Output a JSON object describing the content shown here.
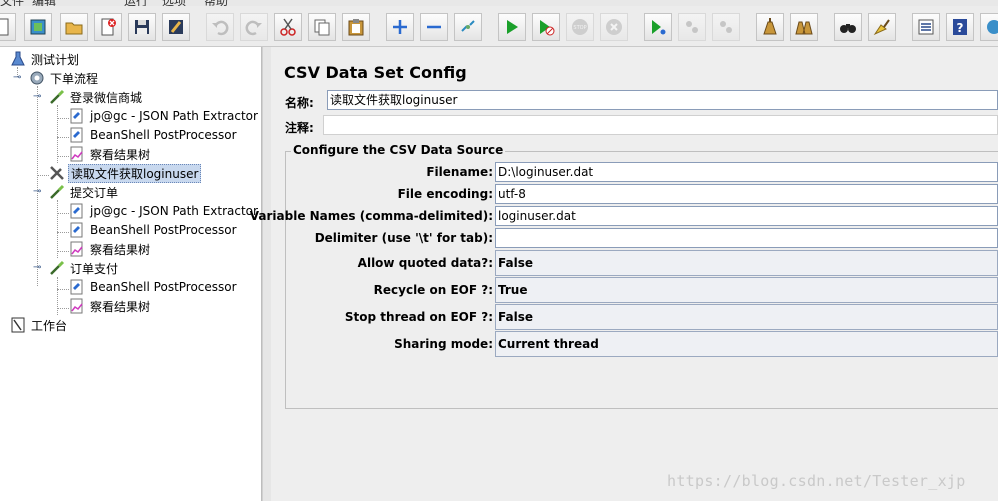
{
  "menubar": {
    "items": [
      "文件",
      "编辑",
      "运行",
      "选项",
      "帮助"
    ]
  },
  "toolbar": {
    "buttons": [
      {
        "name": "new-icon"
      },
      {
        "name": "templates-icon"
      },
      {
        "name": "open-icon"
      },
      {
        "name": "close-icon"
      },
      {
        "name": "save-icon"
      },
      {
        "name": "save-as-icon"
      },
      {
        "name": "undo-icon"
      },
      {
        "name": "redo-icon"
      },
      {
        "name": "cut-icon"
      },
      {
        "name": "copy-icon"
      },
      {
        "name": "paste-icon"
      },
      {
        "name": "expand-icon"
      },
      {
        "name": "collapse-icon"
      },
      {
        "name": "toggle-icon"
      },
      {
        "name": "start-icon"
      },
      {
        "name": "start-no-pause-icon"
      },
      {
        "name": "stop-icon"
      },
      {
        "name": "shutdown-icon"
      },
      {
        "name": "remote-start-icon"
      },
      {
        "name": "remote-stop-icon"
      },
      {
        "name": "remote-shutdown-icon"
      },
      {
        "name": "clear-icon"
      },
      {
        "name": "clear-all-icon"
      },
      {
        "name": "search-icon"
      },
      {
        "name": "reset-search-icon"
      },
      {
        "name": "function-helper-icon"
      },
      {
        "name": "help-icon"
      }
    ]
  },
  "tree": {
    "nodes": [
      {
        "label": "测试计划",
        "icon": "test-plan-icon"
      },
      {
        "label": "下单流程",
        "icon": "thread-group-icon"
      },
      {
        "label": "登录微信商城",
        "icon": "sampler-icon"
      },
      {
        "label": "jp@gc - JSON Path Extractor",
        "icon": "postprocessor-icon"
      },
      {
        "label": "BeanShell PostProcessor",
        "icon": "postprocessor-icon"
      },
      {
        "label": "察看结果树",
        "icon": "listener-icon"
      },
      {
        "label": "读取文件获取loginuser",
        "icon": "config-element-icon"
      },
      {
        "label": "提交订单",
        "icon": "sampler-icon"
      },
      {
        "label": "jp@gc - JSON Path Extractor",
        "icon": "postprocessor-icon"
      },
      {
        "label": "BeanShell PostProcessor",
        "icon": "postprocessor-icon"
      },
      {
        "label": "察看结果树",
        "icon": "listener-icon"
      },
      {
        "label": "订单支付",
        "icon": "sampler-icon"
      },
      {
        "label": "BeanShell PostProcessor",
        "icon": "postprocessor-icon"
      },
      {
        "label": "察看结果树",
        "icon": "listener-icon"
      },
      {
        "label": "工作台",
        "icon": "workbench-icon"
      }
    ]
  },
  "panel": {
    "title": "CSV Data Set Config",
    "name_label": "名称:",
    "name_value": "读取文件获取loginuser",
    "comment_label": "注释:",
    "comment_value": "",
    "datasource": {
      "title": "Configure the CSV Data Source",
      "filename_label": "Filename:",
      "filename_value": "D:\\loginuser.dat",
      "encoding_label": "File encoding:",
      "encoding_value": "utf-8",
      "varnames_label": "Variable Names (comma-delimited):",
      "varnames_value": "loginuser.dat",
      "delimiter_label": "Delimiter (use '\\t' for tab):",
      "delimiter_value": "",
      "quoted_label": "Allow quoted data?:",
      "quoted_value": "False",
      "recycle_label": "Recycle on EOF ?:",
      "recycle_value": "True",
      "stopthread_label": "Stop thread on EOF ?:",
      "stopthread_value": "False",
      "sharing_label": "Sharing mode:",
      "sharing_value": "Current thread"
    }
  },
  "watermark": "https://blog.csdn.net/Tester_xjp"
}
